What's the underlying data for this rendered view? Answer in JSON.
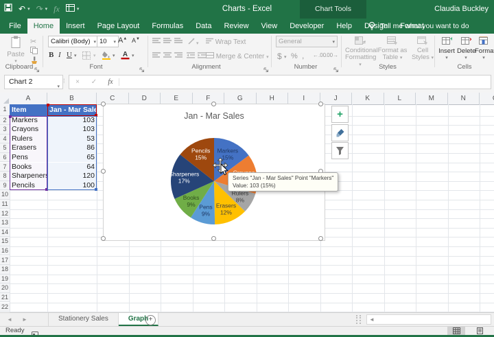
{
  "app": {
    "title": "Charts - Excel",
    "user": "Claudia Buckley",
    "contextual_label": "Chart Tools",
    "tell_me": "Tell me what you want to do",
    "status": "Ready"
  },
  "menu_tabs": [
    {
      "label": "File",
      "type": "file"
    },
    {
      "label": "Home",
      "active": true
    },
    {
      "label": "Insert"
    },
    {
      "label": "Page Layout"
    },
    {
      "label": "Formulas"
    },
    {
      "label": "Data"
    },
    {
      "label": "Review"
    },
    {
      "label": "View"
    },
    {
      "label": "Developer"
    },
    {
      "label": "Help"
    },
    {
      "label": "Design",
      "contextual": true
    },
    {
      "label": "Format",
      "contextual": true
    }
  ],
  "ribbon": {
    "clipboard": {
      "label": "Clipboard",
      "paste": "Paste"
    },
    "font": {
      "label": "Font",
      "name": "Calibri (Body)",
      "size": "10",
      "bold": "B",
      "italic": "I",
      "underline": "U"
    },
    "alignment": {
      "label": "Alignment",
      "wrap": "Wrap Text",
      "merge": "Merge & Center"
    },
    "number": {
      "label": "Number",
      "format": "General",
      "currency": "$",
      "percent": "%",
      "comma": ",",
      "inc_dec": ".00",
      "dec_dec": ".00"
    },
    "styles": {
      "label": "Styles",
      "buttons": [
        [
          "Conditional",
          "Formatting"
        ],
        [
          "Format as",
          "Table"
        ],
        [
          "Cell",
          "Styles"
        ]
      ]
    },
    "cells": {
      "label": "Cells",
      "buttons": [
        "Insert",
        "Delete",
        "Format"
      ]
    }
  },
  "formula_bar": {
    "name_box": "Chart 2",
    "formula": ""
  },
  "grid": {
    "columns": [
      "A",
      "B",
      "C",
      "D",
      "E",
      "F",
      "G",
      "H",
      "I",
      "J",
      "K",
      "L",
      "M",
      "N",
      "O"
    ],
    "row_count": 22,
    "table": {
      "header": [
        "Item",
        "Jan - Mar Sales"
      ],
      "rows": [
        [
          "Markers",
          "103"
        ],
        [
          "Crayons",
          "103"
        ],
        [
          "Rulers",
          "53"
        ],
        [
          "Erasers",
          "86"
        ],
        [
          "Pens",
          "65"
        ],
        [
          "Books",
          "64"
        ],
        [
          "Sharpeners",
          "120"
        ],
        [
          "Pencils",
          "100"
        ]
      ]
    },
    "range_colors": {
      "series_name": "#C00000",
      "categories": "#7030A0",
      "values": "#4472C4"
    }
  },
  "chart_data": {
    "type": "pie",
    "title": "Jan - Mar Sales",
    "series_name": "Jan - Mar Sales",
    "categories": [
      "Markers",
      "Crayons",
      "Rulers",
      "Erasers",
      "Pens",
      "Books",
      "Sharpeners",
      "Pencils"
    ],
    "values": [
      103,
      103,
      53,
      86,
      65,
      64,
      120,
      100
    ],
    "percent_labels": [
      "15%",
      "15%",
      "8%",
      "12%",
      "9%",
      "9%",
      "17%",
      "15%"
    ],
    "colors": [
      "#4472C4",
      "#ED7D31",
      "#A5A5A5",
      "#FFC000",
      "#5B9BD5",
      "#70AD47",
      "#264478",
      "#9E480E"
    ],
    "label_colors": [
      "#1F3864",
      "#FFFFFF",
      "#3F3F3F",
      "#3F3F3F",
      "#1F3864",
      "#2F4F1F",
      "#FFFFFF",
      "#FFFFFF"
    ],
    "legend": "none",
    "start_angle": 0,
    "data_labels": "category name and percentage"
  },
  "chart_tooltip": {
    "line1": "Series \"Jan - Mar Sales\" Point \"Markers\"",
    "line2": "Value: 103 (15%)"
  },
  "sheet_tabs": {
    "items": [
      {
        "label": "Stationery Sales",
        "active": false
      },
      {
        "label": "Graph",
        "active": true
      }
    ]
  },
  "icons": {
    "dropdown": "▾",
    "undo": "↶",
    "redo": "↷",
    "fx": "fx",
    "scissors": "✂",
    "check": "✓",
    "close": "×",
    "nav_left": "◄",
    "nav_right": "►",
    "plus": "+",
    "dollar": "$",
    "percent": "%",
    "comma": ","
  }
}
